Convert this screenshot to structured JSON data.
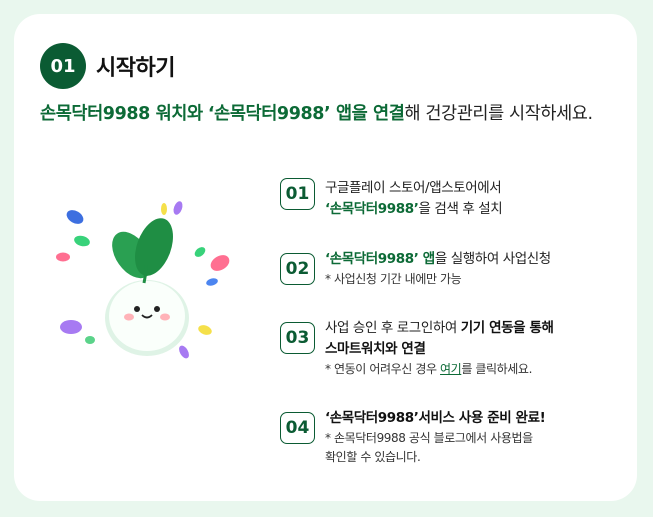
{
  "header": {
    "step_number": "01",
    "title": "시작하기"
  },
  "intro": {
    "watch_name": "손목닥터9988 워치와",
    "app_name": "‘손목닥터9988’ 앱을 연결",
    "rest": "해 건강관리를 시작하세요."
  },
  "steps": [
    {
      "number": "01",
      "line1": "구글플레이 스토어/앱스토어에서",
      "line2_highlight": "‘손목닥터9988’",
      "line2_rest": "을 검색 후 설치"
    },
    {
      "number": "02",
      "line1_highlight": "‘손목닥터9988’ 앱",
      "line1_rest": "을 실행하여 사업신청",
      "note": "* 사업신청 기간 내에만 가능"
    },
    {
      "number": "03",
      "line1_plain": "사업 승인 후 로그인하여 ",
      "line1_bold": "기기 연동을 통해",
      "line2_bold": "스마트워치와 연결",
      "note_before": "* 연동이 어려우신 경우 ",
      "note_link": "여기",
      "note_after": "를 클릭하세요."
    },
    {
      "number": "04",
      "line1_bold": "‘손목닥터9988’서비스 사용 준비 완료!",
      "note_line1": "* 손목닥터9988 공식 블로그에서 사용법을",
      "note_line2": "확인할 수 있습니다."
    }
  ],
  "colors": {
    "accent": "#0b5b33",
    "highlight": "#0c6a36",
    "background": "#e9f7ee"
  }
}
